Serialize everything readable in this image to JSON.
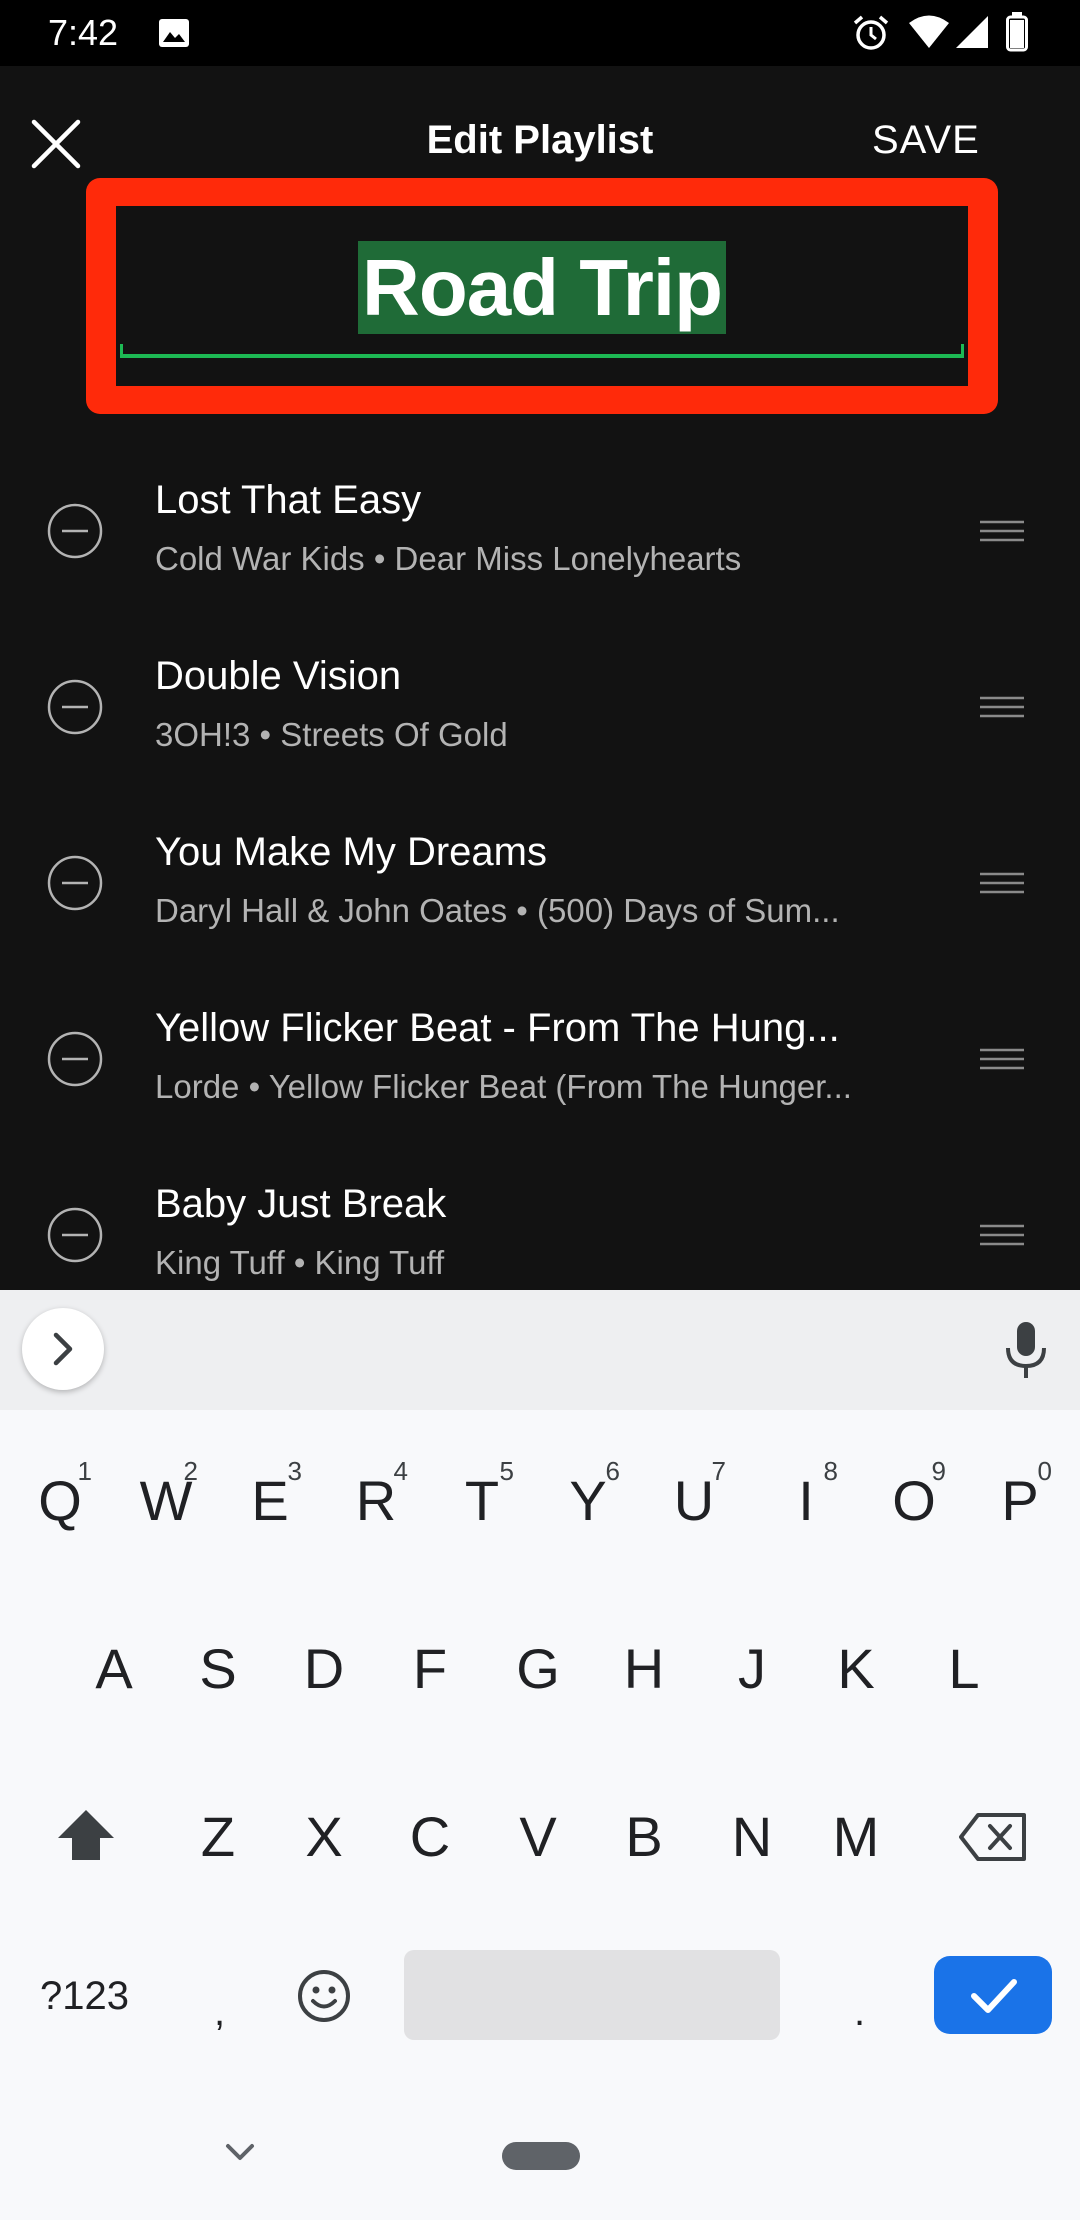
{
  "status_bar": {
    "time": "7:42"
  },
  "header": {
    "title": "Edit Playlist",
    "save_label": "SAVE"
  },
  "playlist_name": "Road Trip",
  "tracks": [
    {
      "title": "Lost That Easy",
      "subtitle": "Cold War Kids • Dear Miss Lonelyhearts"
    },
    {
      "title": "Double Vision",
      "subtitle": "3OH!3 • Streets Of Gold"
    },
    {
      "title": "You Make My Dreams",
      "subtitle": "Daryl Hall & John Oates • (500) Days of Sum..."
    },
    {
      "title": "Yellow Flicker Beat - From The Hung...",
      "subtitle": "Lorde • Yellow Flicker Beat (From The Hunger..."
    },
    {
      "title": "Baby Just Break",
      "subtitle": "King Tuff • King Tuff"
    }
  ],
  "keyboard": {
    "row1": [
      "Q",
      "W",
      "E",
      "R",
      "T",
      "Y",
      "U",
      "I",
      "O",
      "P"
    ],
    "row1_hints": [
      "1",
      "2",
      "3",
      "4",
      "5",
      "6",
      "7",
      "8",
      "9",
      "0"
    ],
    "row2": [
      "A",
      "S",
      "D",
      "F",
      "G",
      "H",
      "J",
      "K",
      "L"
    ],
    "row3": [
      "Z",
      "X",
      "C",
      "V",
      "B",
      "N",
      "M"
    ],
    "symbols_label": "?123",
    "comma": ",",
    "period": "."
  },
  "colors": {
    "accent": "#1db954",
    "highlight_frame": "#ff2a0a",
    "selection": "#1f6b37",
    "enter": "#1a73e8"
  }
}
